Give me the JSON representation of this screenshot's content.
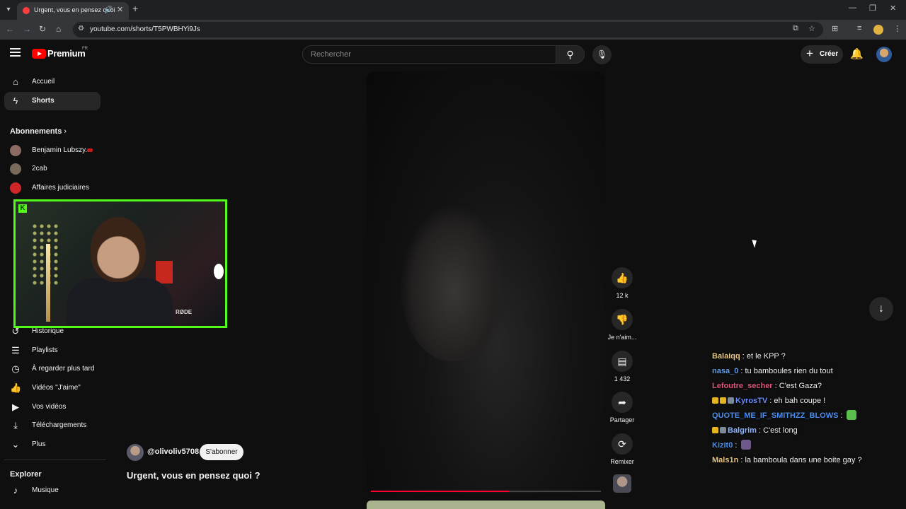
{
  "browser": {
    "tab_title": "Urgent, vous en pensez quoi ?",
    "url": "youtube.com/shorts/T5PWBHYi9Js",
    "new_tab": "+",
    "close": "✕",
    "minimize": "—",
    "restore": "❐",
    "window_close": "✕"
  },
  "header": {
    "logo_text": "Premium",
    "country": "FR",
    "search_placeholder": "Rechercher",
    "create_label": "Créer"
  },
  "sidebar": {
    "main": [
      {
        "label": "Accueil",
        "icon": "home-icon"
      },
      {
        "label": "Shorts",
        "icon": "shorts-icon",
        "active": true
      }
    ],
    "subscriptions_title": "Abonnements",
    "subscriptions": [
      {
        "label": "Benjamin Lubszy...",
        "live": true,
        "color": "#8a6a62"
      },
      {
        "label": "2cab",
        "live": false,
        "color": "#7a6a5a"
      },
      {
        "label": "Affaires judiciaires",
        "live": false,
        "color": "#d0262a"
      }
    ],
    "you": [
      {
        "label": "Historique",
        "icon": "history-icon"
      },
      {
        "label": "Playlists",
        "icon": "playlist-icon"
      },
      {
        "label": "À regarder plus tard",
        "icon": "clock-icon"
      },
      {
        "label": "Vidéos \"J'aime\"",
        "icon": "thumb-up-icon"
      },
      {
        "label": "Vos vidéos",
        "icon": "video-icon"
      },
      {
        "label": "Téléchargements",
        "icon": "download-icon"
      },
      {
        "label": "Plus",
        "icon": "chevron-down-icon"
      }
    ],
    "explore_title": "Explorer",
    "explore": [
      {
        "label": "Musique",
        "icon": "music-icon"
      }
    ]
  },
  "webcam": {
    "mic_brand": "RØDE"
  },
  "short": {
    "channel": "@olivoliv5708",
    "subscribe": "S'abonner",
    "title": "Urgent, vous en pensez quoi ?",
    "progress": 0.6
  },
  "actions": {
    "likes": "12 k",
    "dislike": "Je n'aim...",
    "comments": "1 432",
    "share": "Partager",
    "remix": "Remixer"
  },
  "chat": [
    {
      "user": "Balaiqq",
      "color": "#e8c680",
      "message": "et le KPP ?",
      "badges": []
    },
    {
      "user": "nasa_0",
      "color": "#5f9ded",
      "message": "tu bamboules rien du tout",
      "badges": []
    },
    {
      "user": "Lefoutre_secher",
      "color": "#e0557a",
      "message": "C'est Gaza?",
      "badges": []
    },
    {
      "user": "KyrosTV",
      "color": "#6a8dff",
      "message": "eh bah coupe !",
      "badges": [
        "#e6b422",
        "#e6b422",
        "#7c8a99"
      ]
    },
    {
      "user": "QUOTE_ME_IF_SMITHZZ_BLOWS",
      "color": "#4a8ff0",
      "message": "",
      "badges": [],
      "emote": "#5bbf4d"
    },
    {
      "user": "Balgrim",
      "color": "#8fb7ff",
      "message": "C'est long",
      "badges": [
        "#e6b422",
        "#7c8a99"
      ]
    },
    {
      "user": "Kizit0",
      "color": "#4a8ff0",
      "message": "",
      "badges": [],
      "emote": "#6e5a8a"
    },
    {
      "user": "Mals1n",
      "color": "#e8c680",
      "message": "la bamboula dans une boite gay ?",
      "badges": []
    }
  ]
}
